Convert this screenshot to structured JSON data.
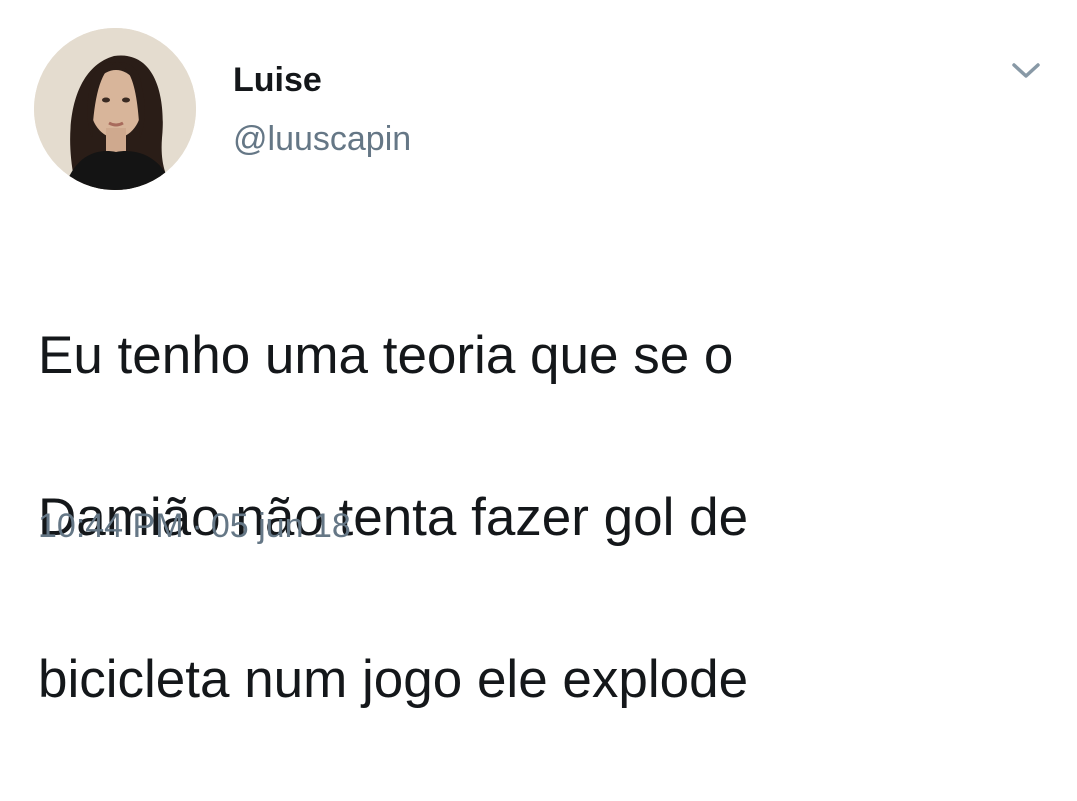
{
  "tweet": {
    "display_name": "Luise",
    "handle": "@luuscapin",
    "text_lines": [
      "Eu tenho uma teoria que se o",
      "Damião não tenta fazer gol de",
      "bicicleta num jogo ele explode"
    ],
    "time": "10:44 PM",
    "separator": "·",
    "date": "05 jun 18",
    "icons": {
      "avatar": "profile-photo",
      "menu": "chevron-down-icon"
    },
    "colors": {
      "text": "#14171a",
      "secondary": "#657786",
      "chevron": "#8899a6",
      "background": "#ffffff"
    }
  }
}
